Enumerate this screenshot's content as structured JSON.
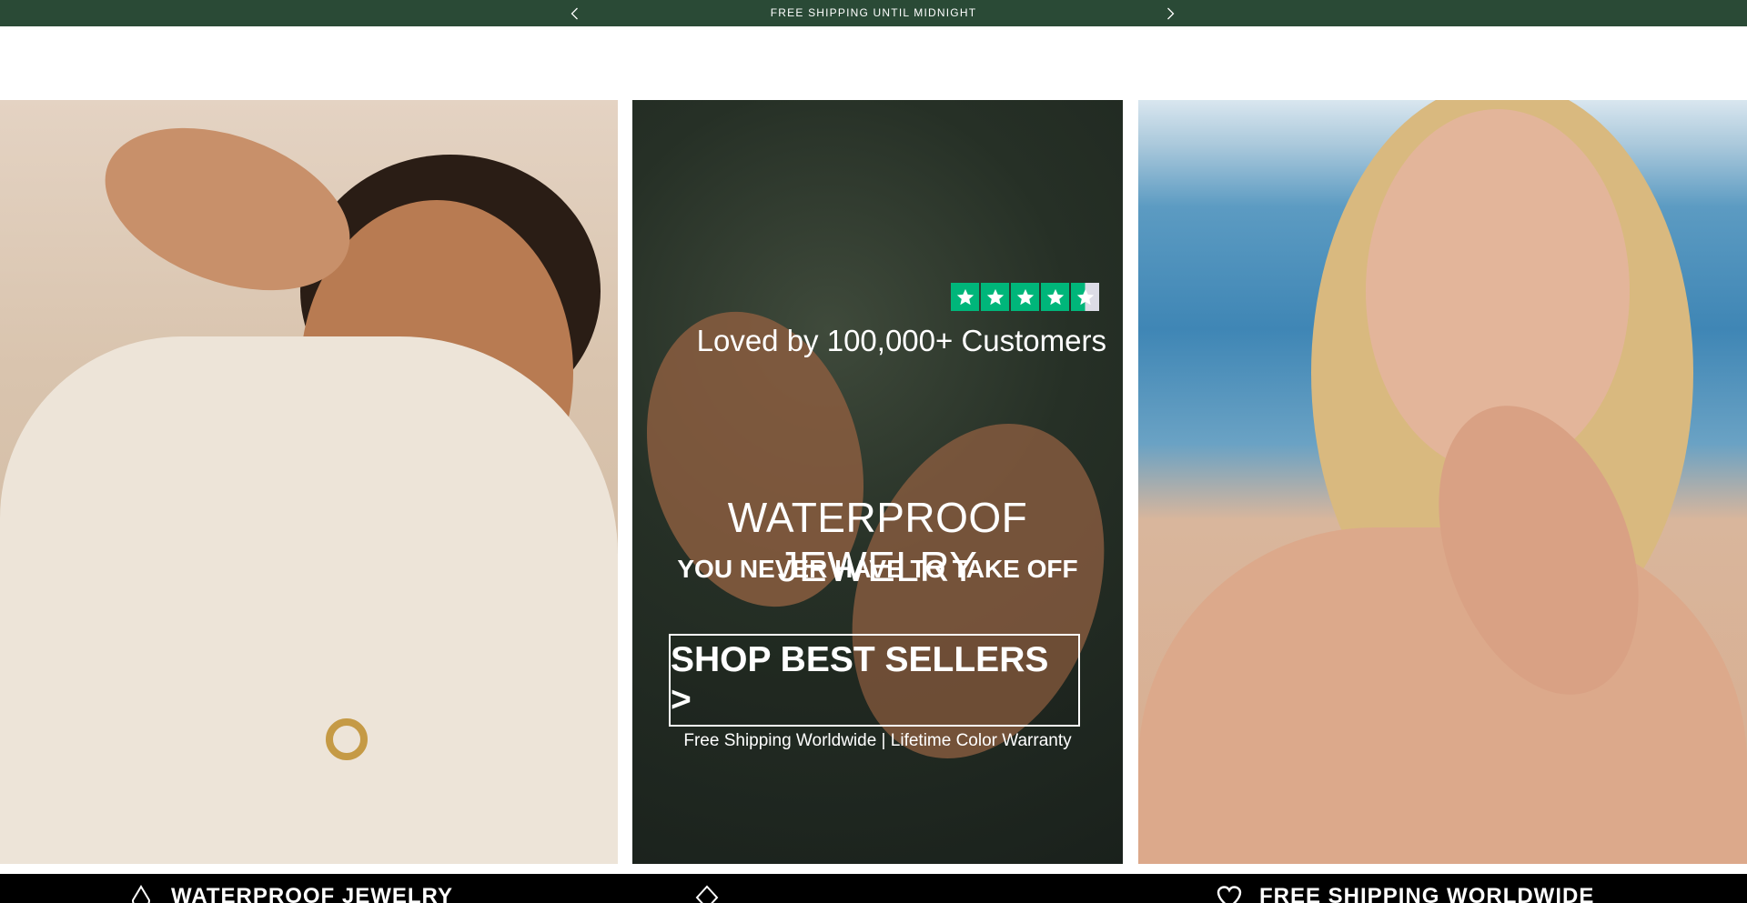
{
  "announcement": {
    "text": "FREE SHIPPING UNTIL MIDNIGHT",
    "prev_icon": "chevron-left-icon",
    "next_icon": "chevron-right-icon"
  },
  "hero": {
    "left_image": "model-beach-crochet-sweater-photo",
    "center": {
      "rating_stars": 4.5,
      "rating_icon": "trustpilot-stars-icon",
      "loved_text": "Loved by 100,000+ Customers",
      "headline": "WATERPROOF JEWELRY",
      "subheadline": "YOU NEVER HAVE TO TAKE OFF",
      "cta_label": "SHOP BEST SELLERS >",
      "footnote": "Free Shipping Worldwide | Lifetime Color Warranty"
    },
    "right_image": "model-ocean-gold-rings-photo"
  },
  "benefits": [
    {
      "icon": "drop-icon",
      "label": "WATERPROOF JEWELRY"
    },
    {
      "icon": "diamond-icon",
      "label": ""
    },
    {
      "icon": "heart-icon",
      "label": "FREE SHIPPING WORLDWIDE"
    }
  ],
  "colors": {
    "announcement_bg": "#2a4a36",
    "trustpilot_green": "#00b67a",
    "strip_bg": "#000000"
  }
}
